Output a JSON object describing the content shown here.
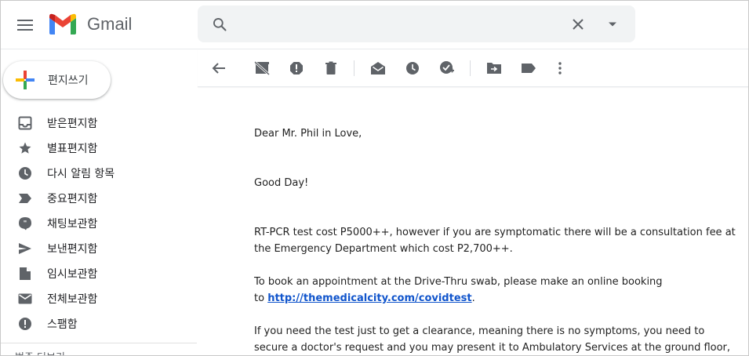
{
  "app": {
    "name": "Gmail"
  },
  "search": {
    "value": "",
    "placeholder": ""
  },
  "compose": {
    "label": "편지쓰기"
  },
  "sidebar": {
    "items": [
      {
        "label": "받은편지함",
        "icon": "inbox-icon"
      },
      {
        "label": "별표편지함",
        "icon": "star-icon"
      },
      {
        "label": "다시 알림 항목",
        "icon": "clock-icon"
      },
      {
        "label": "중요편지함",
        "icon": "label-important-icon"
      },
      {
        "label": "채팅보관함",
        "icon": "chat-icon"
      },
      {
        "label": "보낸편지함",
        "icon": "send-icon"
      },
      {
        "label": "임시보관함",
        "icon": "draft-icon"
      },
      {
        "label": "전체보관함",
        "icon": "mail-icon"
      },
      {
        "label": "스팸함",
        "icon": "report-icon"
      }
    ],
    "more_label": "범주 더보기"
  },
  "toolbar": {
    "icons": [
      "back-arrow-icon",
      "archive-off-icon",
      "report-spam-icon",
      "delete-icon",
      "mark-unread-icon",
      "snooze-icon",
      "add-task-icon",
      "move-to-icon",
      "label-icon",
      "more-vert-icon"
    ]
  },
  "message": {
    "greeting": "Dear Mr. Phil in Love,",
    "salutation": "Good Day!",
    "para1": "RT-PCR test cost P5000++, however if you are symptomatic there will be a consultation fee at the Emergency Department which cost P2,700++.",
    "para2_line1": "To book an appointment at the Drive-Thru swab, please make an online booking",
    "para2_prefix": "to ",
    "para2_link": "http://themedicalcity.com/covidtest",
    "para2_suffix": ".",
    "para3": "If you need the test just to get a clearance, meaning there is no symptoms, you need to secure a doctor's request and you may present it to Ambulatory Services at the ground floor, foyer lobby."
  },
  "colors": {
    "gmail_red": "#EA4335",
    "gmail_blue": "#4285F4",
    "gmail_green": "#34A853",
    "gmail_yellow": "#FBBC04",
    "link": "#1155cc",
    "icon_gray": "#5f6368"
  }
}
